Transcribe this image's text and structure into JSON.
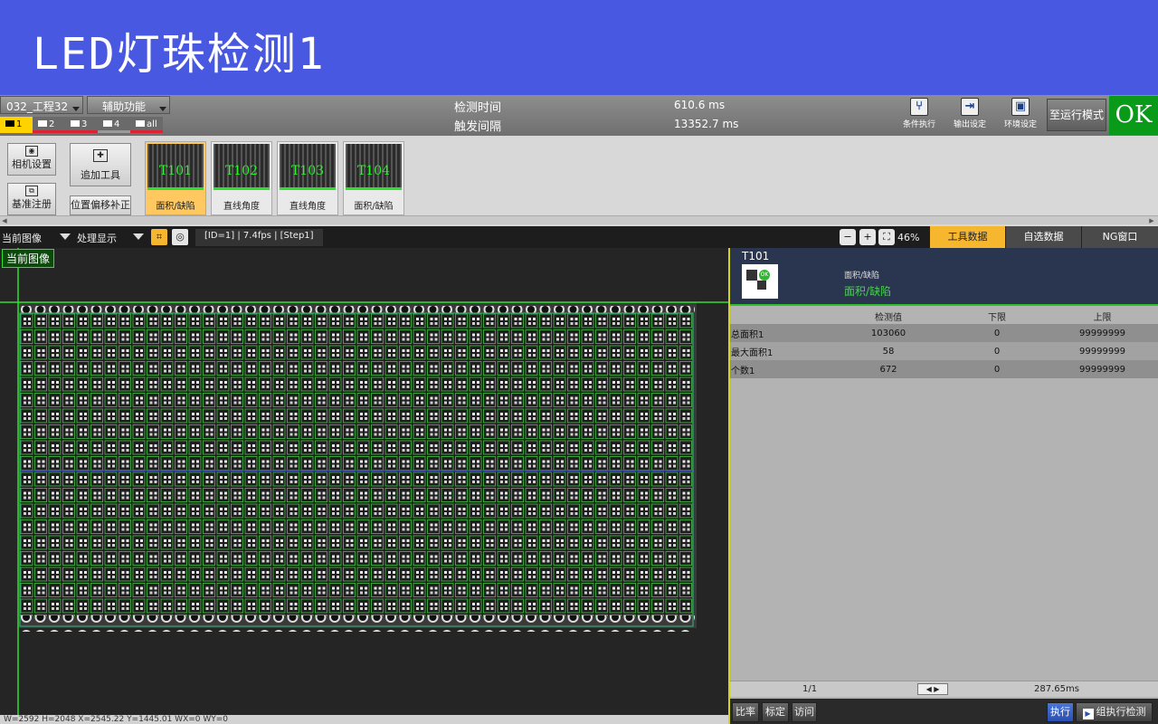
{
  "header": {
    "title": "LED灯珠检测1"
  },
  "status": {
    "project_select": "032_工程32",
    "aux_select": "辅助功能",
    "cam_tabs": [
      "1",
      "2",
      "3",
      "4",
      "all"
    ],
    "detect_time_label": "检测时间",
    "detect_time_value": "610.6 ms",
    "trigger_interval_label": "触发间隔",
    "trigger_interval_value": "13352.7 ms",
    "cond_exec": "条件执行",
    "output_settings": "输出设定",
    "env_settings": "环境设定",
    "run_mode": "至运行模式",
    "result": "OK"
  },
  "tools": {
    "camera_settings": "相机设置",
    "base_register": "基准注册",
    "add_tool": "追加工具",
    "offset_correct": "位置偏移补正",
    "thumbs": [
      {
        "id": "T101",
        "name": "面积/缺陷"
      },
      {
        "id": "T102",
        "name": "直线角度"
      },
      {
        "id": "T103",
        "name": "直线角度"
      },
      {
        "id": "T104",
        "name": "面积/缺陷"
      }
    ]
  },
  "view": {
    "image_select": "当前图像",
    "display_select": "处理显示",
    "info": "[ID=1]  |  7.4fps  |  [Step1]",
    "zoom": "46%",
    "tabs": [
      "工具数据",
      "自选数据",
      "NG窗口"
    ]
  },
  "image": {
    "label": "当前图像",
    "status": "W=2592  H=2048  X=2545.22  Y=1445.01  WX=0 WY=0"
  },
  "panel": {
    "tool_id": "T101",
    "tool_type_small": "面积/缺陷",
    "tool_type": "面积/缺陷",
    "ok_mark": "OK",
    "columns": [
      "",
      "检测值",
      "下限",
      "上限"
    ],
    "rows": [
      [
        "总面积1",
        "103060",
        "0",
        "99999999"
      ],
      [
        "最大面积1",
        "58",
        "0",
        "99999999"
      ],
      [
        "个数1",
        "672",
        "0",
        "99999999"
      ]
    ],
    "page": "1/1",
    "elapsed": "287.65ms",
    "footer": {
      "ratio": "比率",
      "calib": "标定",
      "visit": "访问",
      "exec": "执行",
      "group_exec": "组执行检测"
    }
  },
  "colors": {
    "title_bg": "#4958e0",
    "ok_green": "#0a9a1a",
    "active_tab": "#f6b72e",
    "overlay_green": "#2fe02f"
  }
}
